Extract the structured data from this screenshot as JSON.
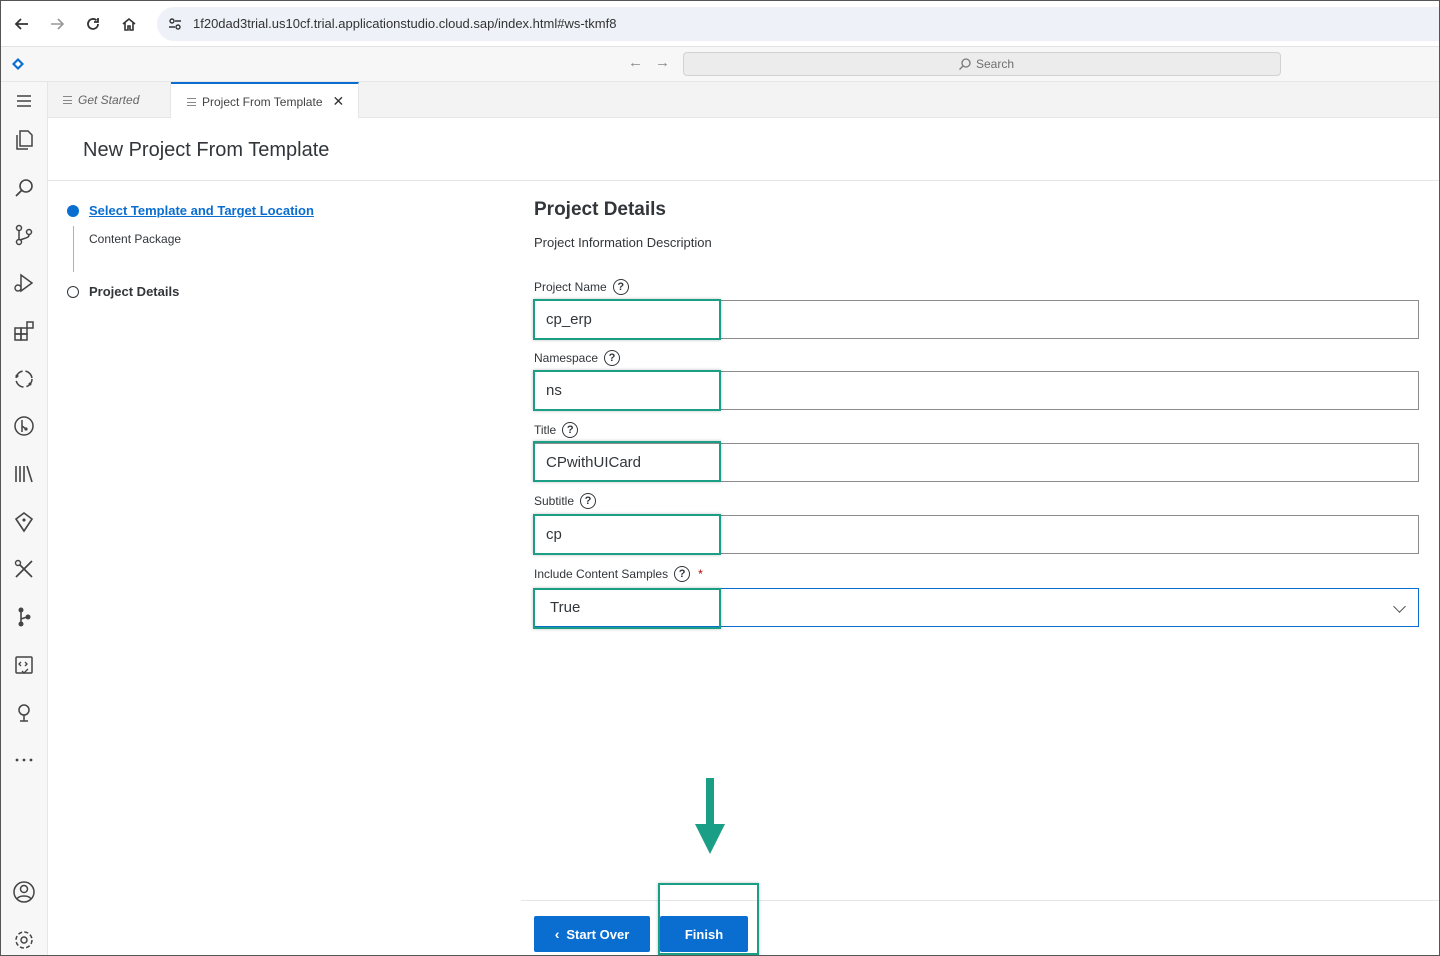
{
  "browser": {
    "url": "1f20dad3trial.us10cf.trial.applicationstudio.cloud.sap/index.html#ws-tkmf8",
    "icons": [
      "back-icon",
      "forward-icon",
      "reload-icon",
      "home-icon",
      "site-settings-icon"
    ]
  },
  "ide": {
    "search_placeholder": "Search",
    "activity_icons": [
      "menu-icon",
      "explorer-icon",
      "search-icon",
      "source-control-icon",
      "run-debug-icon",
      "extensions-icon",
      "cloud-foundry-icon",
      "git-graph-icon",
      "library-icon",
      "sap-icon",
      "tools-icon",
      "branch-icon",
      "code-check-icon",
      "sap-cap-icon",
      "more-icon",
      "account-icon",
      "settings-icon"
    ]
  },
  "tabs": [
    {
      "label": "Get Started"
    },
    {
      "label": "Project From Template"
    }
  ],
  "page": {
    "title": "New Project From Template"
  },
  "wizard": {
    "steps": [
      {
        "label": "Select Template and Target Location",
        "sub": "Content Package"
      },
      {
        "label": "Project Details"
      }
    ]
  },
  "form": {
    "title": "Project Details",
    "description": "Project Information Description",
    "fields": [
      {
        "label": "Project Name",
        "value": "cp_erp"
      },
      {
        "label": "Namespace",
        "value": "ns"
      },
      {
        "label": "Title",
        "value": "CPwithUICard"
      },
      {
        "label": "Subtitle",
        "value": "cp"
      },
      {
        "label": "Include Content Samples",
        "value": "True",
        "required": "*"
      }
    ]
  },
  "actions": {
    "start_over": "Start Over",
    "finish": "Finish"
  },
  "colors": {
    "accent": "#0a6ed1",
    "highlight": "#1a9e85"
  }
}
